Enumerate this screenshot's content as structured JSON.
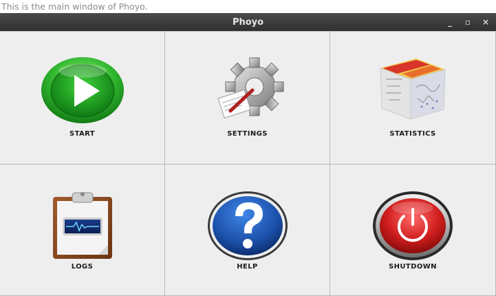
{
  "caption": "This is the main window of Phoyo.",
  "window": {
    "title": "Phoyo",
    "controls": {
      "minimize": "_",
      "maximize": "▫",
      "close": "×"
    }
  },
  "tiles": [
    {
      "label": "START",
      "icon": "play-icon",
      "color": "#2fb52f"
    },
    {
      "label": "SETTINGS",
      "icon": "gear-icon",
      "color": "#9a9a9a"
    },
    {
      "label": "STATISTICS",
      "icon": "statistics-cube-icon",
      "color": "#d8342a"
    },
    {
      "label": "LOGS",
      "icon": "clipboard-monitor-icon",
      "color": "#8a4a26"
    },
    {
      "label": "HELP",
      "icon": "question-icon",
      "color": "#1c4fa8"
    },
    {
      "label": "SHUTDOWN",
      "icon": "power-icon",
      "color": "#d21f1f"
    }
  ]
}
